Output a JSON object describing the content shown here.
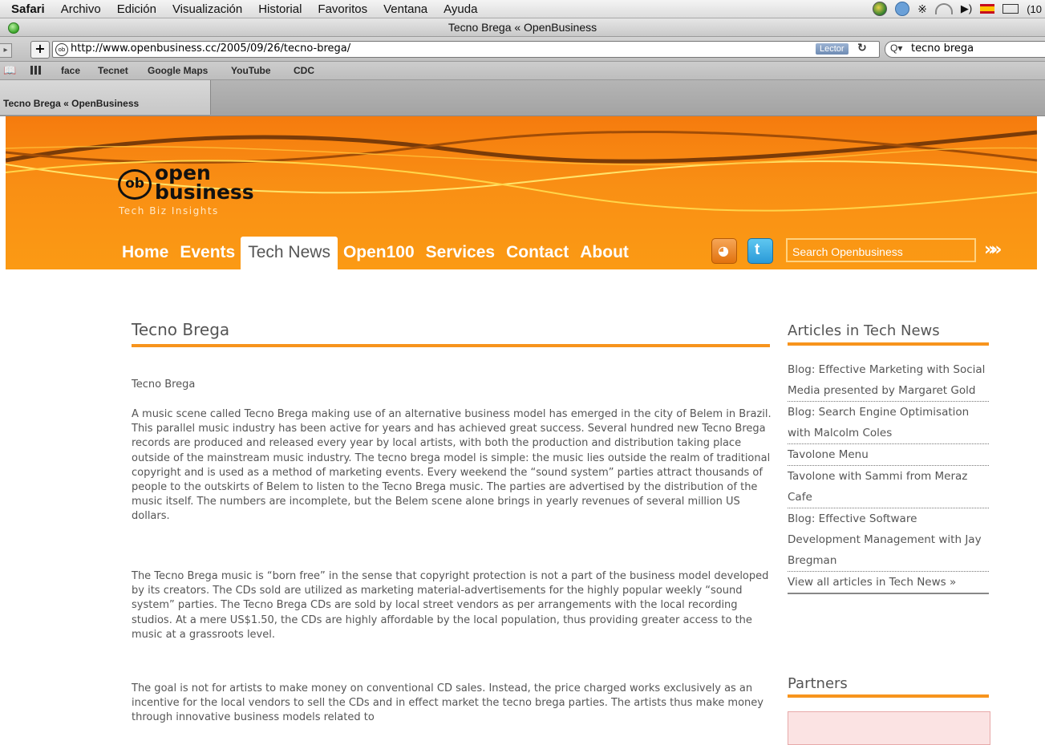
{
  "menubar": {
    "items": [
      "Safari",
      "Archivo",
      "Edición",
      "Visualización",
      "Historial",
      "Favoritos",
      "Ventana",
      "Ayuda"
    ],
    "battery": "(10"
  },
  "window": {
    "title": "Tecno Brega « OpenBusiness"
  },
  "toolbar": {
    "url": "http://www.openbusiness.cc/2005/09/26/tecno-brega/",
    "reader_label": "Lector",
    "search_prefix": "Q▾",
    "search_value": "tecno brega"
  },
  "bookmarks": [
    "face",
    "Tecnet",
    "Google Maps",
    "YouTube",
    "CDC"
  ],
  "tab": {
    "label": "Tecno Brega « OpenBusiness"
  },
  "site": {
    "logo_mark": "ob",
    "logo_line1": "open",
    "logo_line2": "business",
    "tagline": "Tech Biz Insights",
    "nav": [
      "Home",
      "Events",
      "Tech News",
      "Open100",
      "Services",
      "Contact",
      "About"
    ],
    "active_nav": "Tech News",
    "search_placeholder": "Search Openbusiness",
    "header_color": "#f98f14",
    "accent_color": "#f7941d"
  },
  "article": {
    "title": "Tecno Brega",
    "subtitle": "Tecno Brega",
    "paragraphs": [
      "A music scene called Tecno Brega making use of an alternative business model has emerged in the city of Belem in Brazil. This parallel music industry has been active for years and has achieved great success. Several hundred new Tecno Brega records are produced and released every year by local artists, with both the production and distribution taking place outside of the mainstream music industry. The tecno brega model is simple: the music lies outside the realm of traditional copyright and is used as a method of marketing events. Every weekend the “sound system” parties attract thousands of people to the outskirts of Belem to listen to the Tecno Brega music. The parties are advertised by the distribution of the music itself. The numbers are incomplete, but the Belem scene alone brings in yearly revenues of several million US dollars.",
      "The Tecno Brega music is “born free” in the sense that copyright protection is not a part of the business model developed by its creators. The CDs sold are utilized as marketing material-advertisements for the highly popular weekly “sound system” parties. The Tecno Brega CDs are sold by local street vendors as per arrangements with the local recording studios. At a mere US$1.50, the CDs are highly affordable by the local population, thus providing greater access to the music at a grassroots level.",
      "The goal is not for artists to make money on conventional CD sales. Instead, the price charged works exclusively as an incentive for the local vendors to sell the CDs and in effect market the tecno brega parties. The artists thus make money through innovative business models related to"
    ]
  },
  "sidebar": {
    "articles_heading": "Articles in Tech News",
    "articles": [
      "Blog: Effective Marketing with Social Media presented by Margaret Gold",
      "Blog: Search Engine Optimisation with Malcolm Coles",
      "Tavolone Menu",
      "Tavolone with Sammi from Meraz Cafe",
      "Blog: Effective Software Development Management with Jay Bregman",
      "View all articles in Tech News »"
    ],
    "partners_heading": "Partners"
  }
}
